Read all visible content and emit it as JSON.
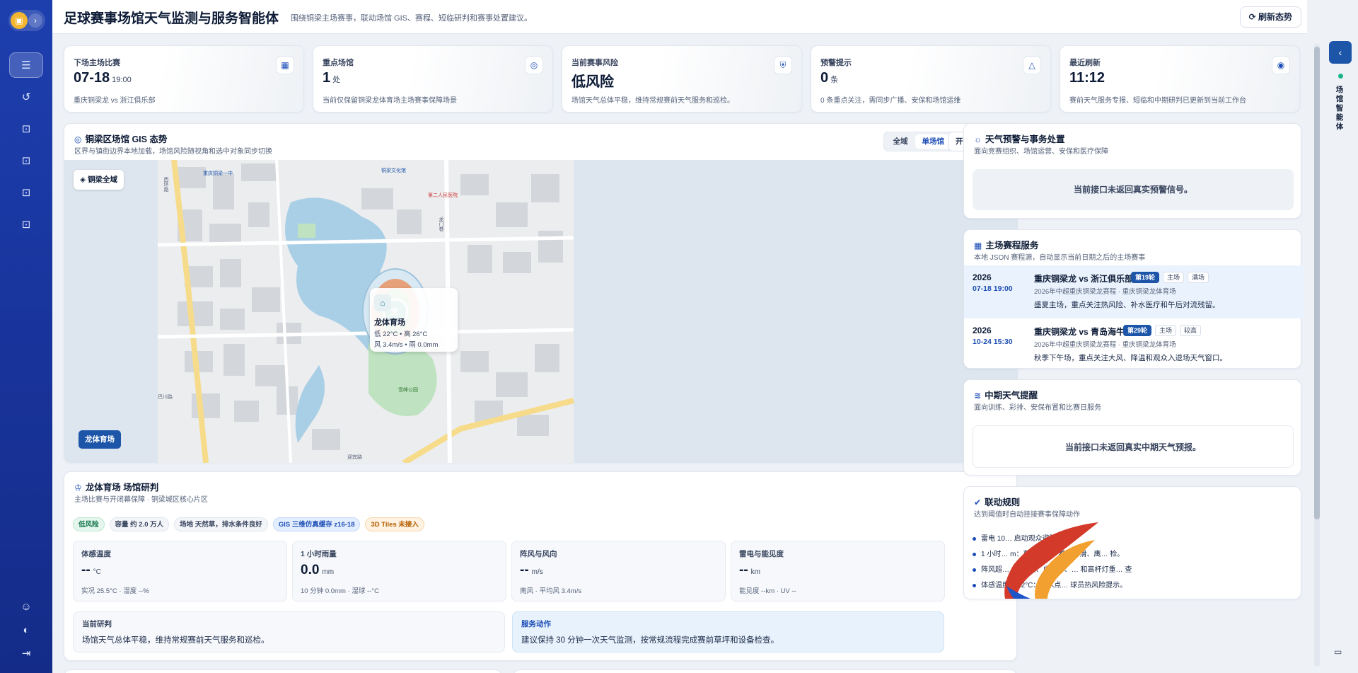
{
  "header": {
    "title": "足球赛事场馆天气监测与服务智能体",
    "subtitle": "围绕铜梁主场赛事，联动场馆 GIS、赛程、短临研判和赛事处置建议。",
    "refresh_label": "刷新态势"
  },
  "sidebar": {
    "logo_icon": "robot-icon",
    "items": [
      {
        "name": "chat-icon",
        "active": true
      },
      {
        "name": "history-icon"
      },
      {
        "name": "bot-icon"
      },
      {
        "name": "bot-icon"
      },
      {
        "name": "bot-icon"
      },
      {
        "name": "bot-icon"
      }
    ],
    "bottom": [
      "user-icon",
      "palette-icon",
      "logout-icon"
    ]
  },
  "kpis": [
    {
      "label": "下场主场比赛",
      "value": "07-18",
      "unit": "19:00",
      "desc": "重庆铜梁龙 vs 浙江俱乐部",
      "icon": "calendar-icon"
    },
    {
      "label": "重点场馆",
      "value": "1",
      "unit": "处",
      "desc": "当前仅保留铜梁龙体育场主场赛事保障场景",
      "icon": "location-icon"
    },
    {
      "label": "当前赛事风险",
      "value": "低风险",
      "unit": "",
      "desc": "场馆天气总体平稳，维持常规赛前天气服务和巡检。",
      "icon": "shield-icon"
    },
    {
      "label": "预警提示",
      "value": "0",
      "unit": "条",
      "desc": "0 条重点关注，需同步广播、安保和场馆运维",
      "icon": "warning-icon"
    },
    {
      "label": "最近刷新",
      "value": "11:12",
      "unit": "",
      "desc": "赛前天气服务专报、短临和中期研判已更新到当前工作台",
      "icon": "radar-icon"
    }
  ],
  "map": {
    "title": "铜梁区场馆 GIS 态势",
    "subtitle": "区界与镇街边界本地加载，场馆风险随视角和选中对象同步切换",
    "seg": [
      "全域",
      "单场馆"
    ],
    "seg_active": 1,
    "auto_label": "开启自动轮播",
    "region_chip": "铜梁全域",
    "venue_chip": "龙体育场",
    "popup": {
      "name": "龙体育场",
      "temp": "低 22°C • 高 26°C",
      "wind": "风 3.4m/s • 雨 0.0mm"
    },
    "stadium_label": "龙",
    "road_labels": [
      "重庆铜梁一中",
      "铜梁文化馆",
      "第二人民医院",
      "西环路",
      "龙门巷",
      "雪峰公园",
      "巴川路",
      "迎宾路"
    ]
  },
  "research": {
    "title": "龙体育场 场馆研判",
    "subtitle": "主场比赛与开闭幕保障 · 铜梁城区核心片区",
    "tags": [
      {
        "text": "低风险",
        "tone": "green"
      },
      {
        "text": "容量 约 2.0 万人",
        "tone": "gray"
      },
      {
        "text": "场地 天然草，排水条件良好",
        "tone": "gray"
      },
      {
        "text": "GIS 三维仿真缓存 z16-18",
        "tone": "blue"
      },
      {
        "text": "3D Tiles 未接入",
        "tone": "orange"
      }
    ],
    "metrics": [
      {
        "label": "体感温度",
        "value": "--",
        "unit": "°C",
        "note": "实况 25.5°C · 湿度 --%"
      },
      {
        "label": "1 小时雨量",
        "value": "0.0",
        "unit": "mm",
        "note": "10 分钟 0.0mm · 湿球 --°C"
      },
      {
        "label": "阵风与风向",
        "value": "--",
        "unit": "m/s",
        "note": "南风 · 平均风 3.4m/s"
      },
      {
        "label": "雷电与能见度",
        "value": "--",
        "unit": "km",
        "note": "能见度 --km · UV --"
      }
    ],
    "current_label": "当前研判",
    "current_text": "场馆天气总体平稳，维持常规赛前天气服务和巡检。",
    "action_label": "服务动作",
    "action_text": "建议保持 30 分钟一次天气监测，按常规流程完成赛前草坪和设备检查。"
  },
  "warning_panel": {
    "title": "天气预警与事务处置",
    "subtitle": "面向竞赛组织、场馆运营、安保和医疗保障",
    "empty": "当前接口未返回真实预警信号。"
  },
  "schedule": {
    "title": "主场赛程服务",
    "subtitle": "本地 JSON 赛程源，自动显示当前日期之后的主场赛事",
    "items": [
      {
        "year": "2026",
        "time": "07-18 19:00",
        "match": "重庆铜梁龙 vs 浙江俱乐部",
        "round": "第19轮",
        "home": "主场",
        "status": "满场",
        "comp": "2026年中超重庆铜梁龙赛程 · 重庆铜梁龙体育场",
        "note": "盛夏主场，重点关注热风险、补水医疗和午后对流残留。"
      },
      {
        "year": "2026",
        "time": "10-24 15:30",
        "match": "重庆铜梁龙 vs 青岛海牛",
        "round": "第29轮",
        "home": "主场",
        "status": "较高",
        "comp": "2026年中超重庆铜梁龙赛程 · 重庆铜梁龙体育场",
        "note": "秋季下午场，重点关注大风、降温和观众入退场天气窗口。"
      }
    ]
  },
  "midterm": {
    "title": "中期天气提醒",
    "subtitle": "面向训练、彩排、安保布置和比赛日服务",
    "empty": "当前接口未返回真实中期天气预报。"
  },
  "rules": {
    "title": "联动规则",
    "subtitle": "达到阈值时自动挂接赛事保障动作",
    "items": [
      "雷电 10… 启动观众避险广播。",
      "1 小时… m：草坪排水、看台防滑、鹰… 检。",
      "阵风超… s：临建、广告牌、… 和高杆灯重… 查",
      "体感温度 ≥ 32°C：补水点… 球员热风险提示。"
    ]
  },
  "rail": {
    "collapse_icon": "chevron-left-icon",
    "vertical_label": "场馆智能体",
    "chat_icon": "comment-icon"
  }
}
